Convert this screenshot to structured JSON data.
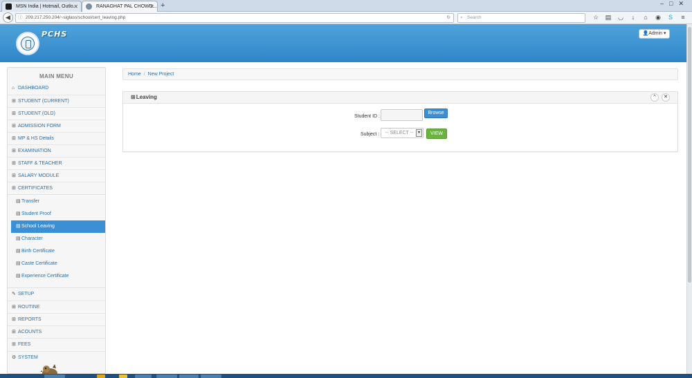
{
  "browser": {
    "tabs": [
      {
        "title": "MSN India | Hotmail, Outlo...",
        "active": false,
        "favicon_color": "#1a1a1a"
      },
      {
        "title": "RANAGHAT PAL CHOWD...",
        "active": true,
        "favicon_color": "#7a8da3"
      }
    ],
    "url": "209.217.250.204/~siglass/school/cert_leaving.php",
    "search_placeholder": "Search"
  },
  "header": {
    "brand": "PCHS",
    "admin_label": "Admin"
  },
  "sidebar": {
    "title": "MAIN MENU",
    "items": [
      {
        "label": "DASHBOARD",
        "icon": "home-icon",
        "glyph": "⌂"
      },
      {
        "label": "STUDENT (CURRENT)",
        "icon": "grid-icon",
        "glyph": "⊞"
      },
      {
        "label": "STUDENT (OLD)",
        "icon": "grid-icon",
        "glyph": "⊞"
      },
      {
        "label": "ADMISSION FORM",
        "icon": "grid-icon",
        "glyph": "⊞"
      },
      {
        "label": "MP & HS Details",
        "icon": "grid-icon",
        "glyph": "⊞"
      },
      {
        "label": "EXAMINATION",
        "icon": "grid-icon",
        "glyph": "⊞"
      },
      {
        "label": "STAFF & TEACHER",
        "icon": "grid-icon",
        "glyph": "⊞"
      },
      {
        "label": "SALARY MODULE",
        "icon": "grid-icon",
        "glyph": "⊞"
      },
      {
        "label": "CERTIFICATES",
        "icon": "grid-icon",
        "glyph": "⊞"
      }
    ],
    "sub_items": [
      {
        "label": "Transfer",
        "active": false
      },
      {
        "label": "Student Proof",
        "active": false
      },
      {
        "label": "School Leaving",
        "active": true
      },
      {
        "label": "Character",
        "active": false
      },
      {
        "label": "Birth Certificate",
        "active": false
      },
      {
        "label": "Caste Certificate",
        "active": false
      },
      {
        "label": "Experience Certificate",
        "active": false
      }
    ],
    "lower_items": [
      {
        "label": "SETUP",
        "icon": "wrench-icon",
        "glyph": "✎"
      },
      {
        "label": "ROUTINE",
        "icon": "grid-icon",
        "glyph": "⊞"
      },
      {
        "label": "REPORTS",
        "icon": "grid-icon",
        "glyph": "⊞"
      },
      {
        "label": "ACOUNTS",
        "icon": "grid-icon",
        "glyph": "⊞"
      },
      {
        "label": "FEES",
        "icon": "grid-icon",
        "glyph": "⊞"
      },
      {
        "label": "SYSTEM",
        "icon": "cogs-icon",
        "glyph": "⚙"
      }
    ]
  },
  "breadcrumb": {
    "home": "Home",
    "current": "New Project"
  },
  "panel": {
    "title": "Leaving",
    "student_id_label": "Student ID :",
    "student_id_value": "",
    "browse_label": "Browse",
    "subject_label": "Subject :",
    "subject_selected": "-- SELECT --",
    "view_label": "VIEW"
  },
  "colors": {
    "header_blue": "#2f86c8",
    "active_menu": "#3b8fd5",
    "link_blue": "#2a6fa8",
    "view_green": "#6ab33f"
  }
}
